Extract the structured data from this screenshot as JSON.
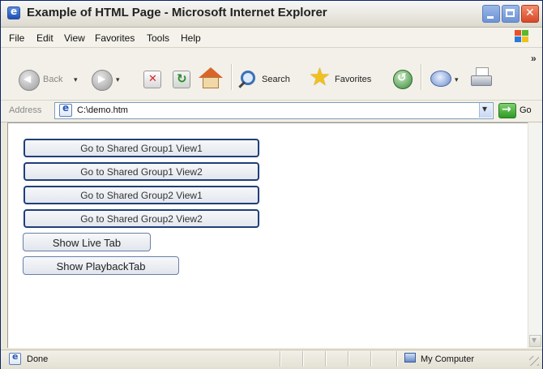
{
  "window": {
    "title": "Example of HTML Page - Microsoft Internet Explorer"
  },
  "menu": {
    "items": [
      "File",
      "Edit",
      "View",
      "Favorites",
      "Tools",
      "Help"
    ]
  },
  "toolbar": {
    "back_label": "Back",
    "search_label": "Search",
    "favorites_label": "Favorites"
  },
  "address": {
    "label": "Address",
    "value": "C:\\demo.htm",
    "go_label": "Go"
  },
  "content": {
    "buttons": [
      "Go to Shared Group1 View1",
      "Go to Shared Group1 View2",
      "Go to Shared Group2 View1",
      "Go to Shared Group2 View2",
      "Show Live Tab",
      "Show PlaybackTab"
    ]
  },
  "status": {
    "text": "Done",
    "zone": "My Computer"
  },
  "colors": {
    "button_border": "#1f3f7a",
    "chrome": "#ece9d8",
    "close_button": "#d8482a"
  }
}
